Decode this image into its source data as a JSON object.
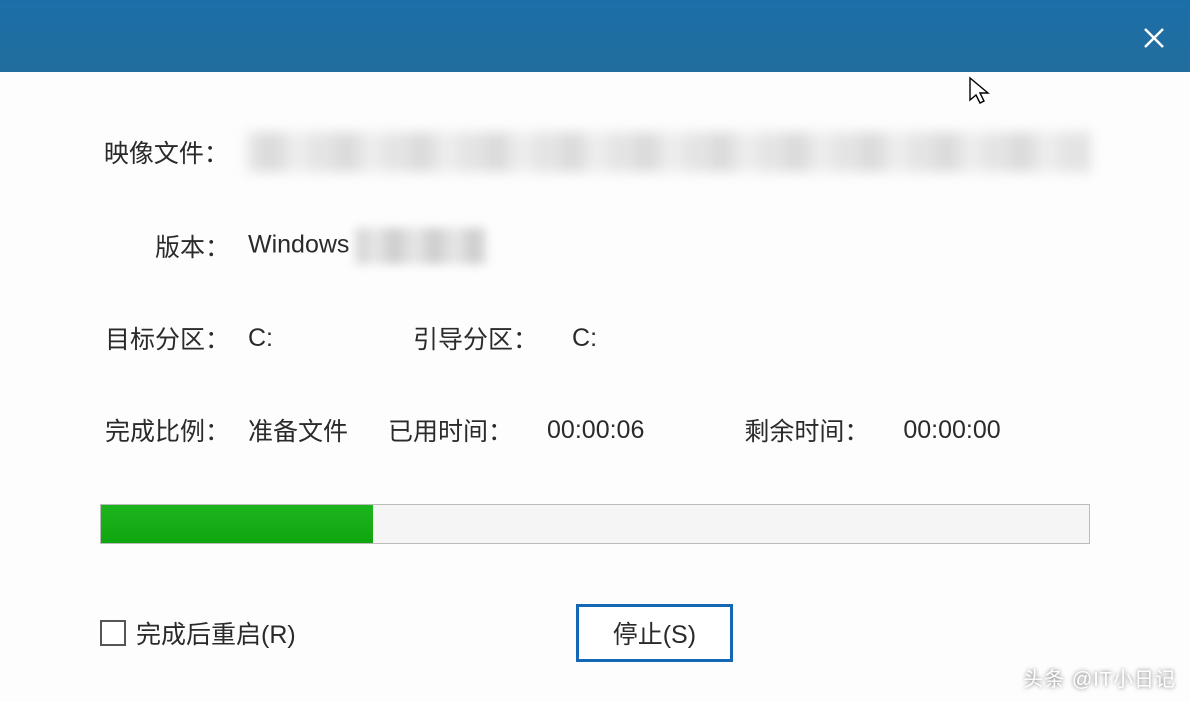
{
  "labels": {
    "image_file": "映像文件：",
    "version": "版本：",
    "target_partition": "目标分区：",
    "boot_partition": "引导分区：",
    "completion_ratio": "完成比例：",
    "elapsed_time": "已用时间：",
    "remaining_time": "剩余时间："
  },
  "values": {
    "version_prefix": "Windows",
    "target_partition": "C:",
    "boot_partition": "C:",
    "completion_status": "准备文件",
    "elapsed_time": "00:00:06",
    "remaining_time": "00:00:00"
  },
  "progress": {
    "percent": 27.5
  },
  "controls": {
    "restart_checkbox_label": "完成后重启(R)",
    "stop_button": "停止(S)"
  },
  "watermark": "头条 @IT小日记"
}
